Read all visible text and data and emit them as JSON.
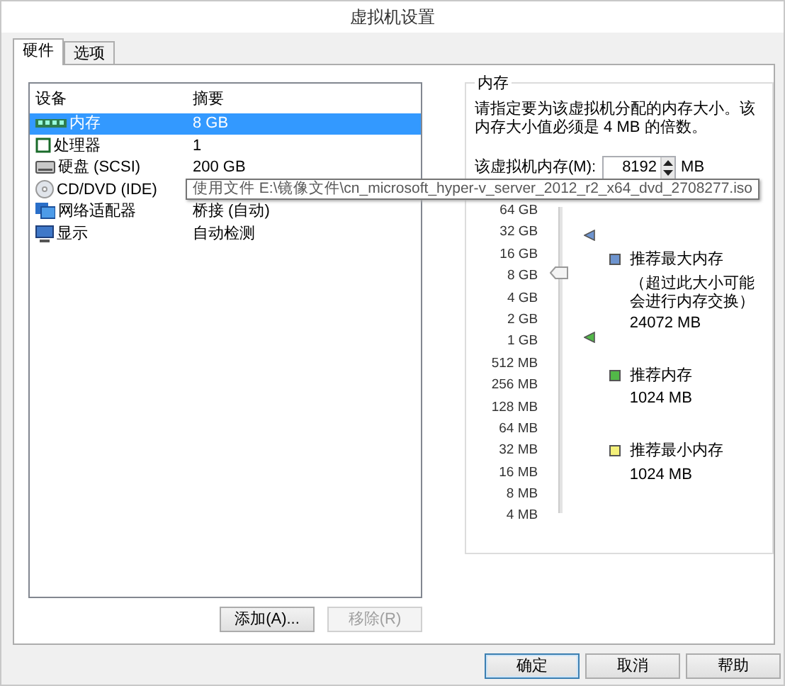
{
  "window": {
    "title": "虚拟机设置"
  },
  "tabs": [
    {
      "label": "硬件",
      "selected": true
    },
    {
      "label": "选项",
      "selected": false
    }
  ],
  "device_table": {
    "columns": [
      "设备",
      "摘要"
    ],
    "rows": [
      {
        "kind": "memory",
        "device": "内存",
        "summary": "8 GB",
        "selected": true
      },
      {
        "kind": "cpu",
        "device": "处理器",
        "summary": "1",
        "selected": false
      },
      {
        "kind": "disk",
        "device": "硬盘 (SCSI)",
        "summary": "200 GB",
        "selected": false
      },
      {
        "kind": "cdrom",
        "device": "CD/DVD (IDE)",
        "summary": "使用文件 E:\\镜像文件\\cn_microsoft_hyper-v_server_2012_r2_x64_dvd_2708277.iso",
        "selected": false
      },
      {
        "kind": "network",
        "device": "网络适配器",
        "summary": "桥接 (自动)",
        "selected": false
      },
      {
        "kind": "display",
        "device": "显示",
        "summary": "自动检测",
        "selected": false
      }
    ]
  },
  "list_buttons": [
    {
      "label": "添加(A)...",
      "disabled": false
    },
    {
      "label": "移除(R)",
      "disabled": true
    }
  ],
  "memory_panel": {
    "title": "内存",
    "description": "请指定要为该虚拟机分配的内存大小。该内存大小值必须是 4 MB 的倍数。",
    "field_label": "该虚拟机内存(M):",
    "value": "8192",
    "unit": "MB",
    "slider": {
      "level": 0.786,
      "ticks": [
        "64 GB",
        "32 GB",
        "16 GB",
        "8 GB",
        "4 GB",
        "2 GB",
        "1 GB",
        "512 MB",
        "256 MB",
        "128 MB",
        "64 MB",
        "32 MB",
        "16 MB",
        "8 MB",
        "4 MB"
      ]
    },
    "legend": [
      {
        "label": "推荐最大内存",
        "note": "（超过此大小可能会进行内存交换）",
        "value": "24072 MB",
        "color": "#6d94cf",
        "level": 0.91
      },
      {
        "label": "推荐内存",
        "value": "1024 MB",
        "color": "#52b848",
        "level": 0.574
      },
      {
        "label": "推荐最小内存",
        "value": "1024 MB",
        "color": "#f4f07a"
      }
    ]
  },
  "dialog_buttons": [
    {
      "label": "确定",
      "default": true
    },
    {
      "label": "取消",
      "default": false
    },
    {
      "label": "帮助",
      "default": false
    }
  ]
}
